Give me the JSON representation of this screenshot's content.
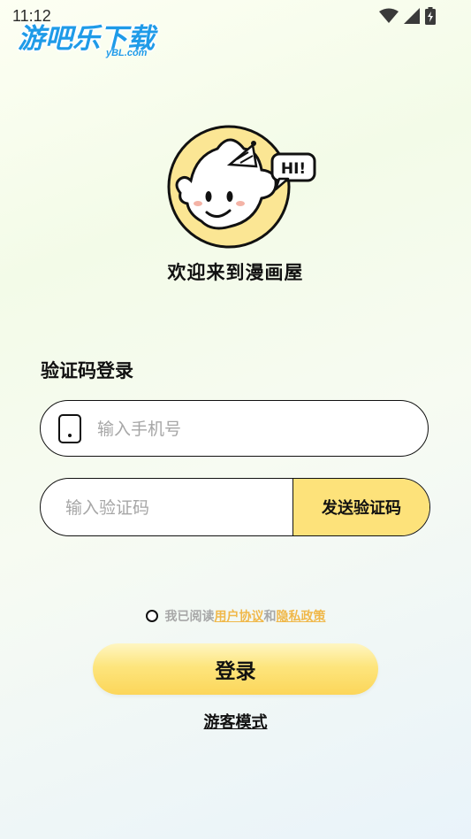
{
  "status_bar": {
    "time": "11:12"
  },
  "watermark": {
    "text": "游吧乐下载",
    "sub": "yBL.com"
  },
  "welcome_text": "欢迎来到漫画屋",
  "mascot_bubble": "HI!",
  "login": {
    "section_title": "验证码登录",
    "phone_placeholder": "输入手机号",
    "code_placeholder": "输入验证码",
    "send_code_label": "发送验证码",
    "agree_prefix": "我已阅读",
    "user_agreement": "用户协议",
    "conjunction": "和",
    "privacy_policy": "隐私政策",
    "login_label": "登录",
    "guest_label": "游客模式"
  },
  "colors": {
    "accent_yellow": "#fde27a",
    "link_orange": "#f0b84a",
    "watermark_blue": "#1f9be8"
  },
  "icons": [
    "wifi-icon",
    "signal-icon",
    "battery-icon",
    "phone-icon",
    "radio-icon",
    "mascot-icon"
  ]
}
